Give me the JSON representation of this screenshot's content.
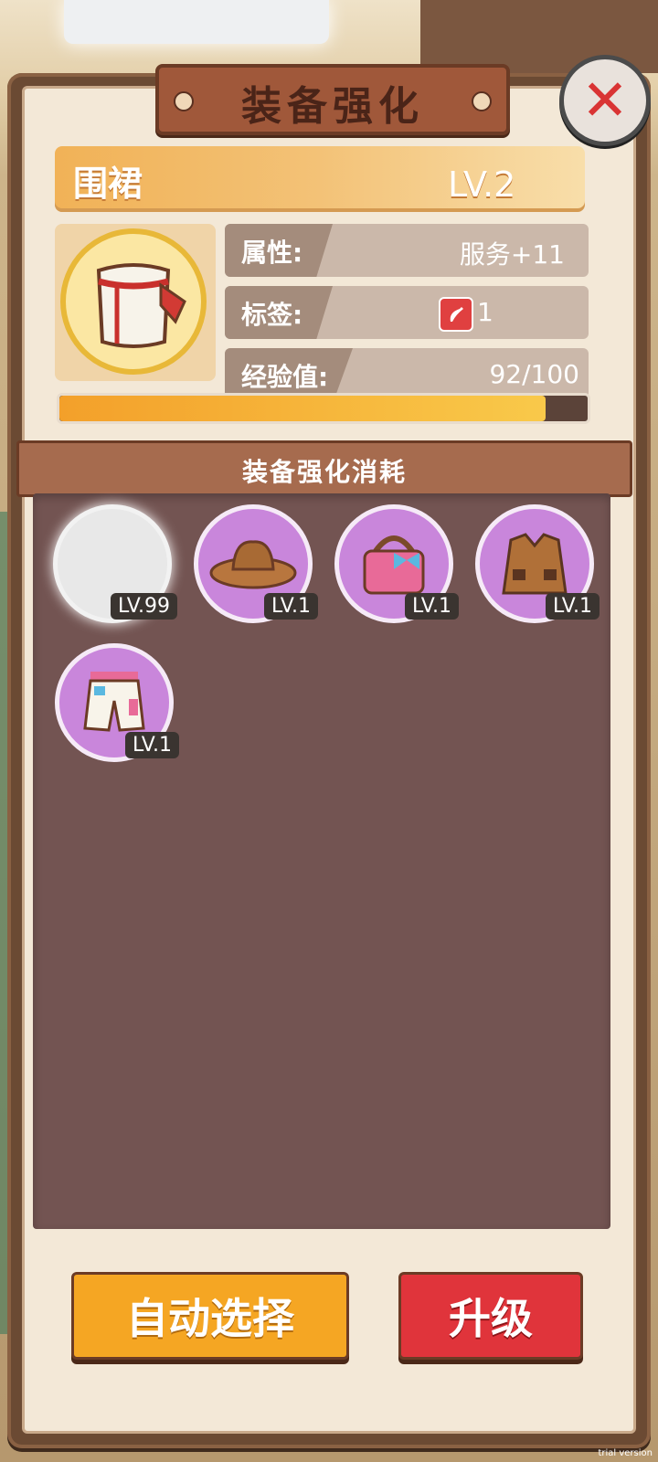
{
  "dialog": {
    "title": "装备强化",
    "close_label": "✕"
  },
  "item": {
    "name": "围裙",
    "level": "LV.2",
    "stats": [
      {
        "label": "属性:",
        "value": "服务+11"
      },
      {
        "label": "标签:",
        "value": "1",
        "icon": "chili-pepper-icon"
      },
      {
        "label": "经验值:",
        "value": "92/100"
      }
    ],
    "exp_progress": 0.92
  },
  "materials": {
    "header": "装备强化消耗",
    "slots": [
      {
        "level": "LV.99",
        "item": "empty-plate"
      },
      {
        "level": "LV.1",
        "item": "cowboy-hat-icon"
      },
      {
        "level": "LV.1",
        "item": "pink-handbag-icon"
      },
      {
        "level": "LV.1",
        "item": "brown-jacket-icon"
      },
      {
        "level": "LV.1",
        "item": "shorts-icon"
      }
    ]
  },
  "buttons": {
    "auto_select": "自动选择",
    "upgrade": "升级"
  },
  "watermark": "trial version",
  "colors": {
    "panel_brown": "#6b4a33",
    "accent_orange": "#f5a623",
    "accent_red": "#e0343b",
    "rarity_purple": "#c986db"
  }
}
